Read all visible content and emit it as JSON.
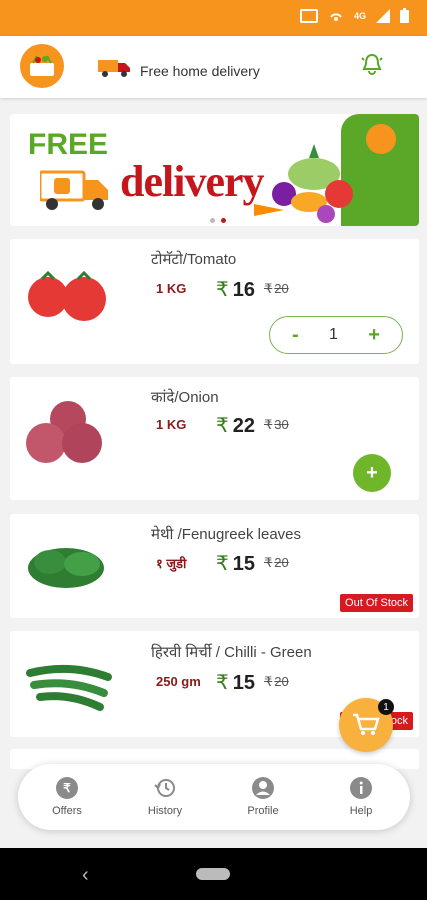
{
  "header": {
    "delivery_text": "Free home delivery"
  },
  "status_bar": {
    "network_label": "4G"
  },
  "banner": {
    "free_text": "FREE",
    "delivery_text": "delivery"
  },
  "currency_symbol": "₹",
  "products": [
    {
      "name": "टोमॅटो/Tomato",
      "unit": "1 KG",
      "price": "16",
      "mrp": "20",
      "quantity": "1",
      "status": "in-cart"
    },
    {
      "name": "कांदे/Onion",
      "unit": "1 KG",
      "price": "22",
      "mrp": "30",
      "status": "available"
    },
    {
      "name": "मेथी /Fenugreek leaves",
      "unit": "१ जुडी",
      "price": "15",
      "mrp": "20",
      "status": "out-of-stock",
      "badge": "Out Of Stock"
    },
    {
      "name": "हिरवी मिर्ची / Chilli - Green",
      "unit": "250 gm",
      "price": "15",
      "mrp": "20",
      "status": "out-of-stock",
      "badge": "Out Of Stock"
    }
  ],
  "qty_controls": {
    "minus": "-",
    "plus": "+"
  },
  "cart": {
    "count": "1"
  },
  "bottom_nav": [
    {
      "label": "Offers",
      "icon": "rupee-icon"
    },
    {
      "label": "History",
      "icon": "history-icon"
    },
    {
      "label": "Profile",
      "icon": "profile-icon"
    },
    {
      "label": "Help",
      "icon": "info-icon"
    }
  ],
  "colors": {
    "brand_orange": "#f7941d",
    "brand_green": "#5ba829",
    "brand_red": "#c4161c"
  }
}
